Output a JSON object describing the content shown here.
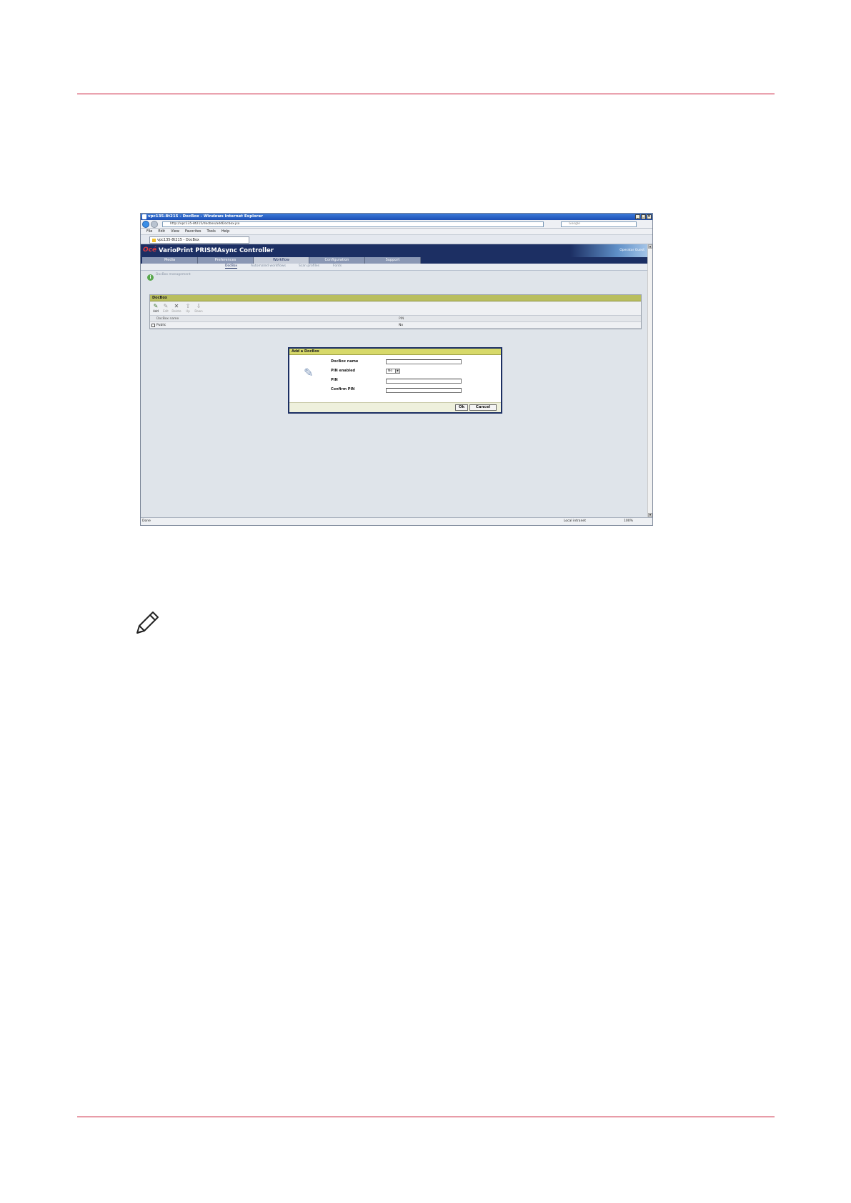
{
  "browser": {
    "window_title": "vpc135-8t215 - DocBox - Windows Internet Explorer",
    "window_buttons": [
      "_",
      "□",
      "×"
    ],
    "url": "http://vpc135-8t215/docbox/addDocbox.jsx",
    "search_placeholder": "Google",
    "menu": [
      "File",
      "Edit",
      "View",
      "Favorites",
      "Tools",
      "Help"
    ],
    "tab_title": "vpc135-8t215 - DocBox"
  },
  "app": {
    "brand": "Océ",
    "title": "VarioPrint PRISMAsync Controller",
    "header_right": "Operator   Guest"
  },
  "nav_tabs": [
    "Media",
    "Preferences",
    "Workflow",
    "Configuration",
    "Support"
  ],
  "sub_tabs": [
    "DocBox",
    "Automated workflows",
    "Scan profiles",
    "Fonts"
  ],
  "info_text": "DocBox management",
  "panel": {
    "title": "DocBox",
    "toolbar": [
      "Add",
      "Edit",
      "Delete",
      "Up",
      "Down"
    ],
    "columns": [
      "DocBox name",
      "PIN"
    ],
    "rows": [
      {
        "name": "Public",
        "pin": "No"
      }
    ]
  },
  "dialog": {
    "title": "Add a DocBox",
    "fields": {
      "docbox_name_label": "DocBox name",
      "pin_enabled_label": "PIN enabled",
      "pin_enabled_value": "No",
      "pin_label": "PIN",
      "confirm_pin_label": "Confirm PIN"
    },
    "ok_label": "Ok",
    "cancel_label": "Cancel"
  },
  "status": {
    "left": "Done",
    "zone": "Local intranet",
    "zoom": "100%"
  }
}
